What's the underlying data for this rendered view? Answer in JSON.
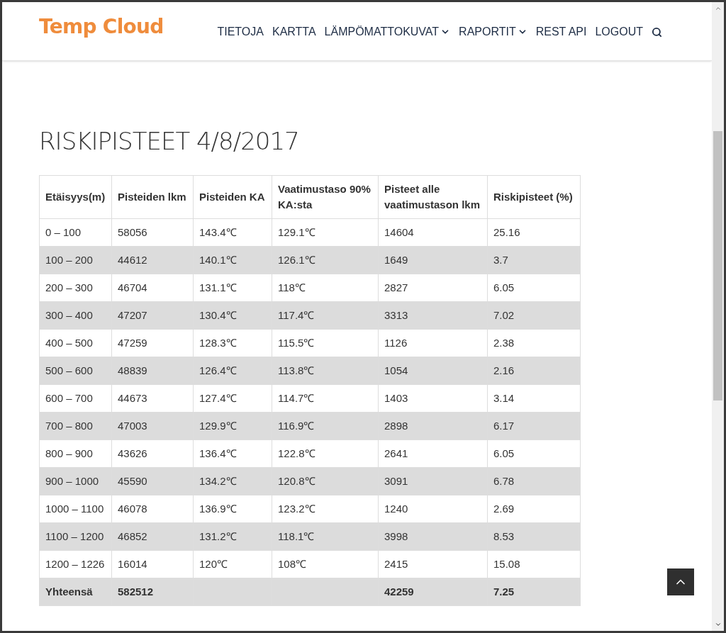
{
  "header": {
    "logo": "Temp Cloud",
    "nav": [
      {
        "label": "TIETOJA",
        "has_dropdown": false
      },
      {
        "label": "KARTTA",
        "has_dropdown": false
      },
      {
        "label": "LÄMPÖMATTOKUVAT",
        "has_dropdown": true
      },
      {
        "label": "RAPORTIT",
        "has_dropdown": true
      },
      {
        "label": "REST API",
        "has_dropdown": false
      },
      {
        "label": "LOGOUT",
        "has_dropdown": false
      }
    ]
  },
  "title": "RISKIPISTEET 4/8/2017",
  "table": {
    "columns": [
      "Etäisyys(m)",
      "Pisteiden lkm",
      "Pisteiden KA",
      "Vaatimustaso 90% KA:sta",
      "Pisteet alle vaatimustason lkm",
      "Riskipisteet (%)"
    ],
    "rows": [
      [
        "0 – 100",
        "58056",
        "143.4℃",
        "129.1℃",
        "14604",
        "25.16"
      ],
      [
        "100 – 200",
        "44612",
        "140.1℃",
        "126.1℃",
        "1649",
        "3.7"
      ],
      [
        "200 – 300",
        "46704",
        "131.1℃",
        "118℃",
        "2827",
        "6.05"
      ],
      [
        "300 – 400",
        "47207",
        "130.4℃",
        "117.4℃",
        "3313",
        "7.02"
      ],
      [
        "400 – 500",
        "47259",
        "128.3℃",
        "115.5℃",
        "1126",
        "2.38"
      ],
      [
        "500 – 600",
        "48839",
        "126.4℃",
        "113.8℃",
        "1054",
        "2.16"
      ],
      [
        "600 – 700",
        "44673",
        "127.4℃",
        "114.7℃",
        "1403",
        "3.14"
      ],
      [
        "700 – 800",
        "47003",
        "129.9℃",
        "116.9℃",
        "2898",
        "6.17"
      ],
      [
        "800 – 900",
        "43626",
        "136.4℃",
        "122.8℃",
        "2641",
        "6.05"
      ],
      [
        "900 – 1000",
        "45590",
        "134.2℃",
        "120.8℃",
        "3091",
        "6.78"
      ],
      [
        "1000 – 1100",
        "46078",
        "136.9℃",
        "123.2℃",
        "1240",
        "2.69"
      ],
      [
        "1100 – 1200",
        "46852",
        "131.2℃",
        "118.1℃",
        "3998",
        "8.53"
      ],
      [
        "1200 – 1226",
        "16014",
        "120℃",
        "108℃",
        "2415",
        "15.08"
      ]
    ],
    "total": {
      "label": "Yhteensä",
      "count": "582512",
      "below_count": "42259",
      "risk": "7.25"
    }
  }
}
